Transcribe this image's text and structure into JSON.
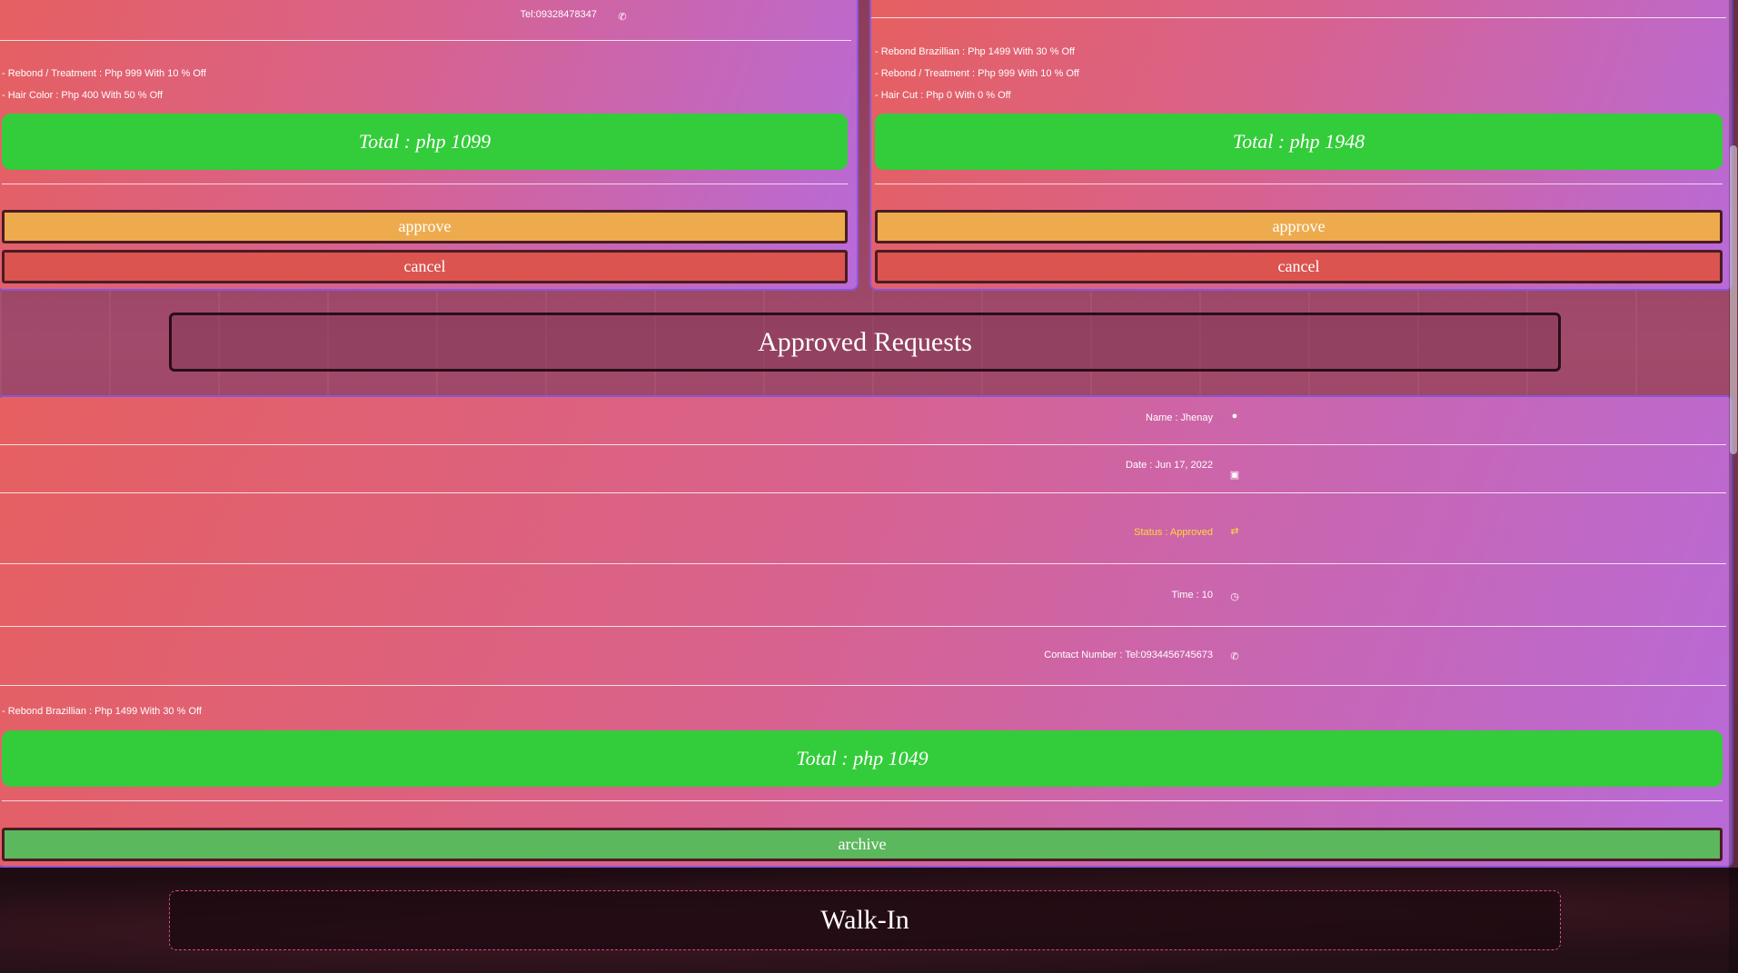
{
  "card1": {
    "contact": "Tel:09328478347",
    "services": [
      "- Rebond / Treatment : Php 999 With 10 % Off",
      "- Hair Color : Php 400 With 50 % Off"
    ],
    "total": "Total : php 1099",
    "approve_label": "approve",
    "cancel_label": "cancel"
  },
  "card2": {
    "services": [
      "- Rebond Brazillian : Php 1499 With 30 % Off",
      "- Rebond / Treatment : Php 999 With 10 % Off",
      "- Hair Cut : Php 0 With 0 % Off"
    ],
    "total": "Total : php 1948",
    "approve_label": "approve",
    "cancel_label": "cancel"
  },
  "approved": {
    "header": "Approved Requests",
    "name": "Name : Jhenay",
    "date": "Date : Jun 17, 2022",
    "status": "Status : Approved",
    "time": "Time : 10",
    "contact": "Contact Number : Tel:0934456745673",
    "services": [
      "- Rebond Brazillian : Php 1499 With 30 % Off"
    ],
    "total": "Total : php 1049",
    "archive_label": "archive"
  },
  "walkin": {
    "header": "Walk-In"
  },
  "icons": {
    "user": "user-circle-icon",
    "calendar": "calendar-icon",
    "status": "exchange-icon",
    "clock": "clock-icon",
    "phone": "phone-icon"
  },
  "colors": {
    "total_bg": "#33cc3a",
    "approve_bg": "#eeab4e",
    "cancel_bg": "#db544f",
    "archive_bg": "#5cb85c",
    "status_text": "#ffd83a"
  }
}
